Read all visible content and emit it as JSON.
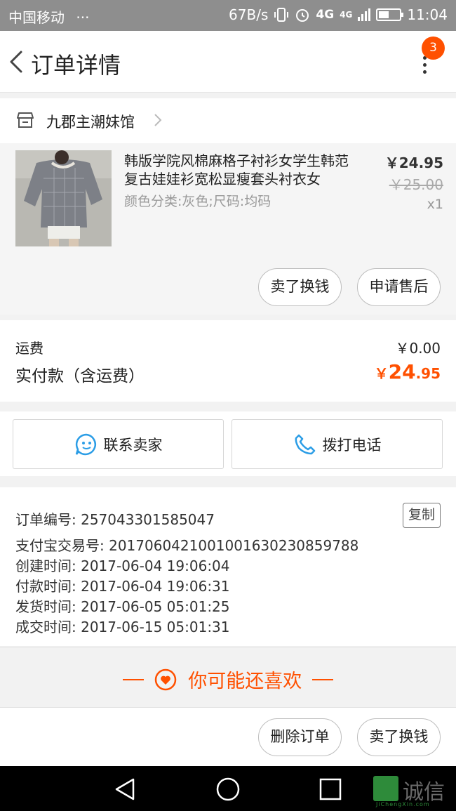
{
  "status_bar": {
    "carrier": "中国移动",
    "dots": "···",
    "speed": "67B/s",
    "network": "4G",
    "network2": "4G",
    "time": "11:04"
  },
  "header": {
    "title": "订单详情",
    "badge_count": "3"
  },
  "shop": {
    "name": "九郡主潮妹馆"
  },
  "product": {
    "name": "韩版学院风棉麻格子衬衫女学生韩范复古娃娃衫宽松显瘦套头衬衣女",
    "spec": "颜色分类:灰色;尺码:均码",
    "price": "￥24.95",
    "original_price": "￥25.00",
    "quantity": "x1",
    "actions": {
      "sell_label": "卖了换钱",
      "aftersale_label": "申请售后"
    }
  },
  "fees": {
    "shipping_label": "运费",
    "shipping_value": "￥0.00",
    "paid_label": "实付款（含运费）",
    "paid_symbol": "￥",
    "paid_int": "24",
    "paid_dec": ".95"
  },
  "contact": {
    "seller_label": "联系卖家",
    "phone_label": "拨打电话"
  },
  "order_info": {
    "order_no": "订单编号: 257043301585047",
    "alipay_no": "支付宝交易号: 2017060421001001630230859788",
    "created": "创建时间: 2017-06-04 19:06:04",
    "paid": "付款时间: 2017-06-04 19:06:31",
    "shipped": "发货时间: 2017-06-05 05:01:25",
    "completed": "成交时间: 2017-06-15 05:01:31",
    "copy_label": "复制"
  },
  "recommend": {
    "label": "你可能还喜欢"
  },
  "bottom_actions": {
    "delete_label": "删除订单",
    "sell_label": "卖了换钱"
  },
  "watermark": {
    "text": "诚信",
    "sub": "JiChengXin.com"
  },
  "colors": {
    "accent": "#ff5000",
    "icon_blue": "#2b9de6"
  }
}
